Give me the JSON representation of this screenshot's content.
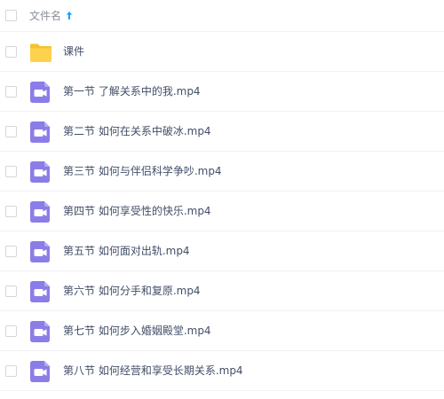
{
  "header": {
    "column_label": "文件名",
    "sort_direction": "ascending"
  },
  "files": [
    {
      "name": "课件",
      "type": "folder"
    },
    {
      "name": "第一节 了解关系中的我.mp4",
      "type": "video"
    },
    {
      "name": "第二节 如何在关系中破冰.mp4",
      "type": "video"
    },
    {
      "name": "第三节 如何与伴侣科学争吵.mp4",
      "type": "video"
    },
    {
      "name": "第四节 如何享受性的快乐.mp4",
      "type": "video"
    },
    {
      "name": "第五节 如何面对出轨.mp4",
      "type": "video"
    },
    {
      "name": "第六节 如何分手和复原.mp4",
      "type": "video"
    },
    {
      "name": "第七节 如何步入婚姻殿堂.mp4",
      "type": "video"
    },
    {
      "name": "第八节 如何经营和享受长期关系.mp4",
      "type": "video"
    }
  ],
  "colors": {
    "folder": "#ffd24d",
    "folder_tab": "#f5c22e",
    "video": "#8b7de8",
    "sort_arrow": "#06a7ff",
    "text": "#424e67",
    "header_text": "#8a8f99"
  }
}
